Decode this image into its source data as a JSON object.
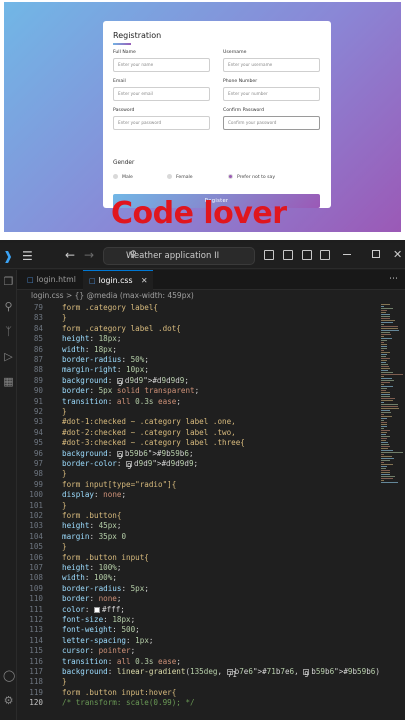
{
  "form": {
    "title": "Registration",
    "fields": [
      {
        "label": "Full Name",
        "placeholder": "Enter your name"
      },
      {
        "label": "Username",
        "placeholder": "Enter your username"
      },
      {
        "label": "Email",
        "placeholder": "Enter your email"
      },
      {
        "label": "Phone Number",
        "placeholder": "Enter your number"
      },
      {
        "label": "Password",
        "placeholder": "Enter your password"
      },
      {
        "label": "Confirm Password",
        "placeholder": "Confirm your password"
      }
    ],
    "gender_title": "Gender",
    "genders": [
      "Male",
      "Female",
      "Prefer not to say"
    ],
    "selected_gender": "Prefer not to say",
    "submit": "Register",
    "gradient": [
      "#71b7e6",
      "#9b59b6"
    ]
  },
  "watermark": "Code lover",
  "vscode": {
    "search": "Weather application II",
    "tabs": [
      {
        "label": "login.html",
        "active": false
      },
      {
        "label": "login.css",
        "active": true
      }
    ],
    "breadcrumb": "login.css > {} @media (max-width: 459px)",
    "lines": [
      {
        "n": "79",
        "t": "  form .category label{"
      },
      {
        "n": "83",
        "t": "  }"
      },
      {
        "n": "84",
        "t": "  form .category label .dot{"
      },
      {
        "n": "85",
        "t": "    height: 18px;"
      },
      {
        "n": "86",
        "t": "    width: 18px;"
      },
      {
        "n": "87",
        "t": "    border-radius: 50%;"
      },
      {
        "n": "88",
        "t": "    margin-right: 10px;"
      },
      {
        "n": "89",
        "t": "    background: #d9d9d9;"
      },
      {
        "n": "90",
        "t": "    border: 5px solid transparent;"
      },
      {
        "n": "91",
        "t": "    transition: all 0.3s ease;"
      },
      {
        "n": "92",
        "t": "  }"
      },
      {
        "n": "93",
        "t": "  #dot-1:checked ~ .category label .one,"
      },
      {
        "n": "94",
        "t": "  #dot-2:checked ~ .category label .two,"
      },
      {
        "n": "95",
        "t": "  #dot-3:checked ~ .category label .three{"
      },
      {
        "n": "96",
        "t": "    background: #9b59b6;"
      },
      {
        "n": "97",
        "t": "    border-color: #d9d9d9;"
      },
      {
        "n": "98",
        "t": "  }"
      },
      {
        "n": "99",
        "t": "  form input[type=\"radio\"]{"
      },
      {
        "n": "100",
        "t": "    display: none;"
      },
      {
        "n": "101",
        "t": "  }"
      },
      {
        "n": "102",
        "t": "  form .button{"
      },
      {
        "n": "103",
        "t": "    height: 45px;"
      },
      {
        "n": "104",
        "t": "    margin: 35px 0"
      },
      {
        "n": "105",
        "t": "  }"
      },
      {
        "n": "106",
        "t": "  form .button input{"
      },
      {
        "n": "107",
        "t": "    height: 100%;"
      },
      {
        "n": "108",
        "t": "    width: 100%;"
      },
      {
        "n": "109",
        "t": "    border-radius: 5px;"
      },
      {
        "n": "110",
        "t": "    border: none;"
      },
      {
        "n": "111",
        "t": "    color: #fff;"
      },
      {
        "n": "112",
        "t": "    font-size: 18px;"
      },
      {
        "n": "113",
        "t": "    font-weight: 500;"
      },
      {
        "n": "114",
        "t": "    letter-spacing: 1px;"
      },
      {
        "n": "115",
        "t": "    cursor: pointer;"
      },
      {
        "n": "116",
        "t": "    transition: all 0.3s ease;"
      },
      {
        "n": "117",
        "t": "    background: linear-gradient(135deg, #71b7e6, #9b59b6);"
      },
      {
        "n": "118",
        "t": "  }"
      },
      {
        "n": "119",
        "t": "  form .button input:hover{"
      },
      {
        "n": "120",
        "t": "    /* transform: scale(0.99); */"
      }
    ]
  }
}
